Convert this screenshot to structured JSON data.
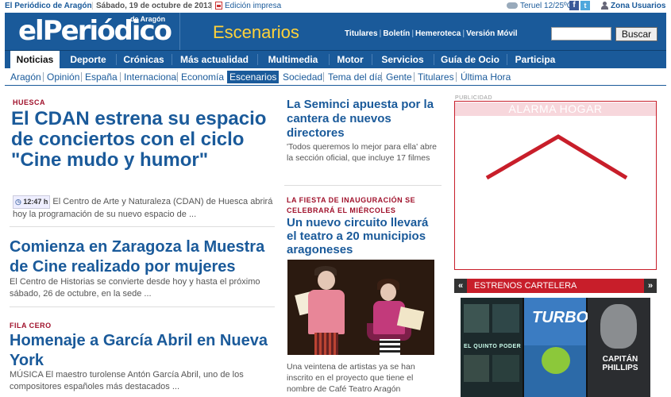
{
  "topbar": {
    "site_name": "El Periódico de Aragón",
    "date": "Sábado, 19 de octubre de 2013",
    "print_edition": "Edición impresa",
    "weather": "Teruel 12/25ºC",
    "user_zone": "Zona Usuarios",
    "facebook_glyph": "f",
    "twitter_glyph": "t"
  },
  "header": {
    "logo": "elPeriódico",
    "logo_sub": "de Aragón",
    "section": "Escenarios",
    "links": [
      "Titulares",
      "Boletín",
      "Hemeroteca",
      "Versión Móvil"
    ],
    "search_placeholder": "",
    "search_button": "Buscar"
  },
  "main_nav": [
    "Noticias",
    "Deporte",
    "Crónicas",
    "Más actualidad",
    "Multimedia",
    "Motor",
    "Servicios",
    "Guía de Ocio",
    "Participa"
  ],
  "sub_nav": [
    "Aragón",
    "Opinión",
    "España",
    "Internacional",
    "Economía",
    "Escenarios",
    "Sociedad",
    "Tema del día",
    "Gente",
    "Titulares",
    "Última Hora"
  ],
  "articles_left": [
    {
      "kicker": "HUESCA",
      "headline": "El CDAN estrena su espacio de conciertos con el ciclo \"Cine mudo y humor\"",
      "time": "12:47 h",
      "summary": "El Centro de Arte y Naturaleza (CDAN) de Huesca abrirá hoy la programación de su nuevo espacio de ..."
    },
    {
      "kicker": "",
      "headline": "Comienza en Zaragoza la Muestra de Cine realizado por mujeres",
      "summary": "El Centro de Historias se convierte desde hoy y hasta el próximo sábado, 26 de octubre, en la sede ..."
    },
    {
      "kicker": "FILA CERO",
      "headline": "Homenaje a García Abril en Nueva York",
      "summary": "MÚSICA El maestro turolense Antón García Abril, uno de los compositores españoles más destacados ..."
    }
  ],
  "articles_middle": [
    {
      "kicker": "",
      "headline": "La Seminci apuesta por la cantera de nuevos directores",
      "summary": "'Todos queremos lo mejor para ella' abre la sección oficial, que incluye 17 filmes"
    },
    {
      "kicker": "LA FIESTA DE INAUGURACIÓN SE CELEBRARÁ EL MIÉRCOLES",
      "headline": "Un nuevo circuito llevará el teatro a 20 municipios aragoneses",
      "summary": "Una veintena de artistas ya se han inscrito en el proyecto que tiene el nombre de Café Teatro Aragón"
    }
  ],
  "ad": {
    "label": "PUBLICIDAD",
    "title": "ALARMA HOGAR",
    "accent": "#c81e2a"
  },
  "estrenos": {
    "title": "ESTRENOS CARTELERA",
    "prev": "«",
    "next": "»",
    "posters": [
      {
        "title": "EL QUINTO PODER"
      },
      {
        "title": "TURBO"
      },
      {
        "title": "CAPITÁN PHILLIPS"
      }
    ]
  }
}
